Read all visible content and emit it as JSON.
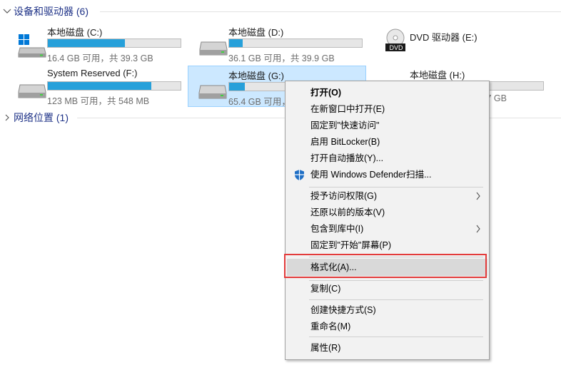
{
  "groups": {
    "devices": {
      "label": "设备和驱动器 (6)"
    },
    "network": {
      "label": "网络位置 (1)"
    }
  },
  "drives": [
    {
      "name": "本地磁盘 (C:)",
      "size": "16.4 GB 可用，共 39.3 GB",
      "used_fraction": 0.58,
      "icon": "windows-drive-icon"
    },
    {
      "name": "本地磁盘 (D:)",
      "size": "36.1 GB 可用，共 39.9 GB",
      "used_fraction": 0.1,
      "icon": "hard-drive-icon"
    },
    {
      "name": "DVD 驱动器 (E:)",
      "icon": "dvd-drive-icon",
      "badge": "DVD"
    },
    {
      "name": "System Reserved (F:)",
      "size": "123 MB 可用，共 548 MB",
      "used_fraction": 0.78,
      "icon": "hard-drive-icon"
    },
    {
      "name": "本地磁盘 (G:)",
      "size": "65.4 GB 可用，",
      "used_fraction": 0.12,
      "icon": "hard-drive-icon"
    },
    {
      "name": "本地磁盘 (H:)",
      "size": ".7 GB",
      "icon": "hard-drive-icon"
    }
  ],
  "context_menu": {
    "open": "打开(O)",
    "open_new_window": "在新窗口中打开(E)",
    "pin_quick_access": "固定到\"快速访问\"",
    "enable_bitlocker": "启用 BitLocker(B)",
    "open_autoplay": "打开自动播放(Y)...",
    "defender_scan": "使用 Windows Defender扫描...",
    "give_access": "授予访问权限(G)",
    "restore_versions": "还原以前的版本(V)",
    "include_library": "包含到库中(I)",
    "pin_start": "固定到\"开始\"屏幕(P)",
    "format": "格式化(A)...",
    "copy": "复制(C)",
    "create_shortcut": "创建快捷方式(S)",
    "rename": "重命名(M)",
    "properties": "属性(R)"
  },
  "colors": {
    "accent": "#26a0da",
    "selection": "#cce8ff",
    "highlight_border": "#e33b3b",
    "group_header": "#1e3287"
  }
}
